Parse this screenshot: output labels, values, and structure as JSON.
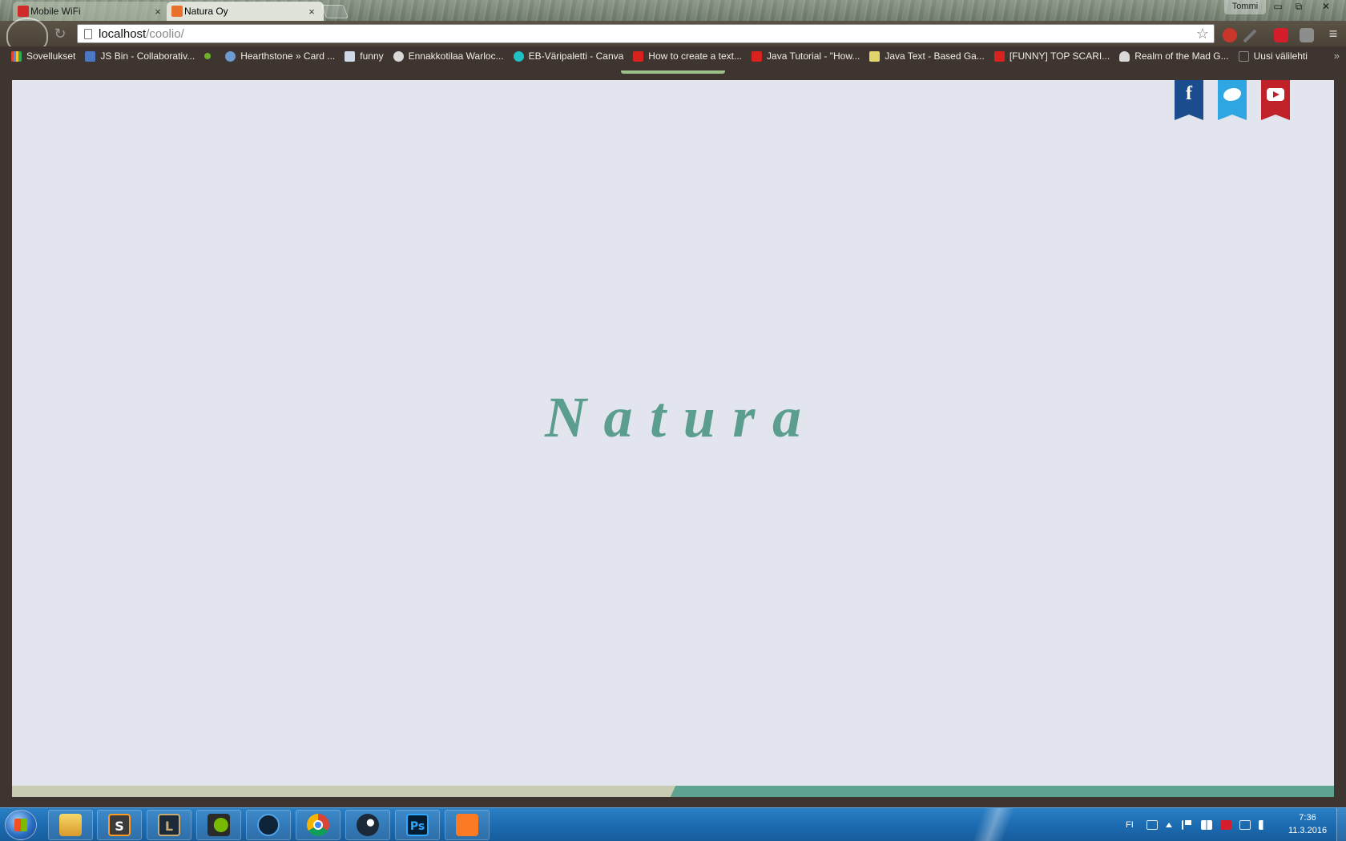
{
  "browser": {
    "tabs": [
      {
        "label": "Mobile WiFi",
        "close": "×"
      },
      {
        "label": "Natura Oy",
        "close": "×"
      }
    ],
    "profile_name": "Tommi",
    "window_buttons": {
      "minimize": "▭",
      "maximize": "⧉",
      "close": "✕"
    },
    "reload_glyph": "↻",
    "url_host": "localhost",
    "url_path": "/coolio/",
    "star_glyph": "☆",
    "menu_glyph": "≡",
    "bookmarks": [
      {
        "label": "Sovellukset",
        "icon": "apps-grid-icon",
        "color": "#e0452b"
      },
      {
        "label": "JS Bin - Collaborativ...",
        "icon": "jsbin-icon",
        "color": "#4b78c4"
      },
      {
        "label": "",
        "icon": "green-dot-icon",
        "color": "#6fb22a"
      },
      {
        "label": "Hearthstone » Card ...",
        "icon": "hearthstone-icon",
        "color": "#6d9bd2"
      },
      {
        "label": "funny",
        "icon": "reddit-icon",
        "color": "#cfd8e6"
      },
      {
        "label": "Ennakkotilaa Warloc...",
        "icon": "steam-icon",
        "color": "#d9d9d9"
      },
      {
        "label": "EB-Väripaletti - Canva",
        "icon": "canva-icon",
        "color": "#1fc1c4"
      },
      {
        "label": "How to create a text...",
        "icon": "youtube-icon",
        "color": "#d8221e"
      },
      {
        "label": "Java Tutorial - \"How...",
        "icon": "youtube-icon",
        "color": "#d8221e"
      },
      {
        "label": "Java Text - Based Ga...",
        "icon": "m-icon",
        "color": "#e1d46a"
      },
      {
        "label": "[FUNNY] TOP SCARI...",
        "icon": "youtube-icon",
        "color": "#d8221e"
      },
      {
        "label": "Realm of the Mad G...",
        "icon": "rotmg-icon",
        "color": "#d9d9d9"
      },
      {
        "label": "Uusi välilehti",
        "icon": "page-icon",
        "color": "#8a8a8a"
      }
    ],
    "bookmarks_more": "»"
  },
  "page": {
    "title": "Natura",
    "social": [
      {
        "name": "facebook",
        "glyph": "f",
        "color": "#1b4d8e"
      },
      {
        "name": "twitter",
        "color": "#2ea6e1"
      },
      {
        "name": "youtube",
        "color": "#c12128"
      }
    ],
    "colors": {
      "background": "#e2e5ee",
      "title": "#5b9e8f",
      "footer_left": "#c7ccb2",
      "footer_right": "#5fa393"
    }
  },
  "taskbar": {
    "apps": [
      "explorer-icon",
      "sublime-text-icon",
      "league-of-legends-icon",
      "nvidia-icon",
      "battlenet-icon",
      "chrome-icon",
      "steam-icon",
      "photoshop-icon",
      "xampp-icon"
    ],
    "photoshop_label": "Ps",
    "sublime_label": "S",
    "league_label": "L",
    "tray_lang": "FI",
    "time": "7:36",
    "date": "11.3.2016"
  }
}
